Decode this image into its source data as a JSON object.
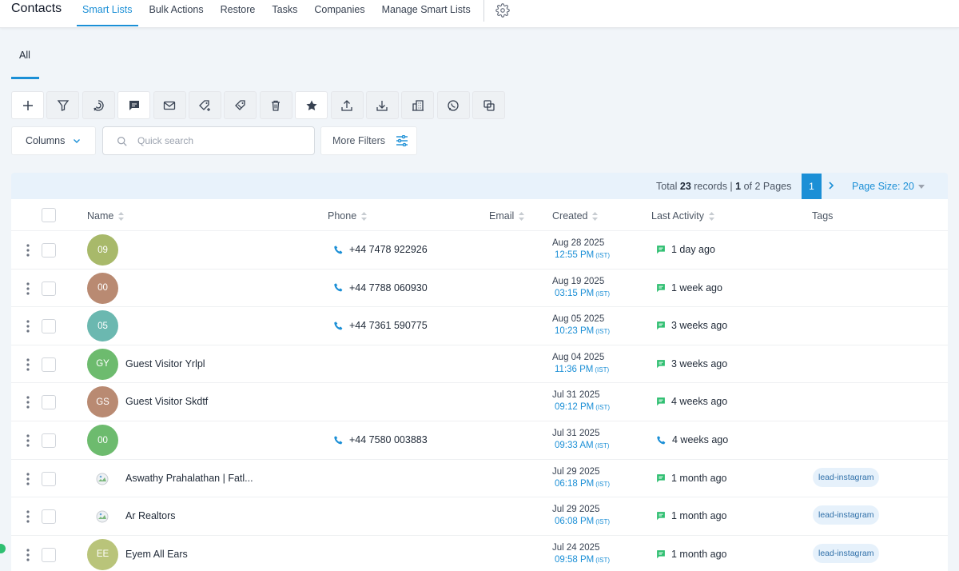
{
  "app": {
    "title": "Contacts"
  },
  "nav": {
    "tabs": [
      {
        "label": "Smart Lists",
        "active": true
      },
      {
        "label": "Bulk Actions"
      },
      {
        "label": "Restore"
      },
      {
        "label": "Tasks"
      },
      {
        "label": "Companies"
      },
      {
        "label": "Manage Smart Lists"
      }
    ]
  },
  "subtabs": {
    "all": "All"
  },
  "toolbar": {
    "buttons": [
      {
        "icon": "plus-icon"
      },
      {
        "icon": "filter-icon"
      },
      {
        "icon": "pipeline-icon"
      },
      {
        "icon": "message-icon"
      },
      {
        "icon": "email-icon"
      },
      {
        "icon": "add-tag-icon"
      },
      {
        "icon": "remove-tag-icon"
      },
      {
        "icon": "delete-icon"
      },
      {
        "icon": "star-icon"
      },
      {
        "icon": "upload-icon"
      },
      {
        "icon": "download-icon"
      },
      {
        "icon": "company-icon"
      },
      {
        "icon": "whatsapp-icon"
      },
      {
        "icon": "merge-icon"
      }
    ]
  },
  "filters": {
    "columns_label": "Columns",
    "search_placeholder": "Quick search",
    "more_filters_label": "More Filters"
  },
  "pager": {
    "total_prefix": "Total ",
    "total_count": "23",
    "total_mid": " records | ",
    "current_page": "1",
    "page_suffix": " of 2 Pages",
    "page_button": "1",
    "page_size": "Page Size: 20"
  },
  "table": {
    "headers": {
      "name": "Name",
      "phone": "Phone",
      "email": "Email",
      "created": "Created",
      "last_activity": "Last Activity",
      "tags": "Tags"
    },
    "rows": [
      {
        "avatar": "09",
        "avatar_color": "#a8b96a",
        "name": "",
        "phone": "+44 7478 922926",
        "date": "Aug 28 2025",
        "time": "12:55 PM",
        "tz": "(IST)",
        "activity": "1 day ago",
        "activity_type": "message",
        "tag": ""
      },
      {
        "avatar": "00",
        "avatar_color": "#b98a72",
        "name": "",
        "phone": "+44 7788 060930",
        "date": "Aug 19 2025",
        "time": "03:15 PM",
        "tz": "(IST)",
        "activity": "1 week ago",
        "activity_type": "message",
        "tag": ""
      },
      {
        "avatar": "05",
        "avatar_color": "#6bb8b0",
        "name": "",
        "phone": "+44 7361 590775",
        "date": "Aug 05 2025",
        "time": "10:23 PM",
        "tz": "(IST)",
        "activity": "3 weeks ago",
        "activity_type": "message",
        "tag": ""
      },
      {
        "avatar": "GY",
        "avatar_color": "#6dbb6e",
        "name": "Guest Visitor Yrlpl",
        "phone": "",
        "date": "Aug 04 2025",
        "time": "11:36 PM",
        "tz": "(IST)",
        "activity": "3 weeks ago",
        "activity_type": "message",
        "tag": ""
      },
      {
        "avatar": "GS",
        "avatar_color": "#b98a72",
        "name": "Guest Visitor Skdtf",
        "phone": "",
        "date": "Jul 31 2025",
        "time": "09:12 PM",
        "tz": "(IST)",
        "activity": "4 weeks ago",
        "activity_type": "message",
        "tag": ""
      },
      {
        "avatar": "00",
        "avatar_color": "#6dbb6e",
        "name": "",
        "phone": "+44 7580 003883",
        "date": "Jul 31 2025",
        "time": "09:33 AM",
        "tz": "(IST)",
        "activity": "4 weeks ago",
        "activity_type": "call",
        "tag": ""
      },
      {
        "avatar": "",
        "avatar_color": "",
        "name": "Aswathy Prahalathan | Fatl...",
        "phone": "",
        "date": "Jul 29 2025",
        "time": "06:18 PM",
        "tz": "(IST)",
        "activity": "1 month ago",
        "activity_type": "message",
        "tag": "lead-instagram"
      },
      {
        "avatar": "",
        "avatar_color": "",
        "name": "Ar Realtors",
        "phone": "",
        "date": "Jul 29 2025",
        "time": "06:08 PM",
        "tz": "(IST)",
        "activity": "1 month ago",
        "activity_type": "message",
        "tag": "lead-instagram"
      },
      {
        "avatar": "EE",
        "avatar_color": "#b9c47a",
        "name": "Eyem All Ears",
        "phone": "",
        "date": "Jul 24 2025",
        "time": "09:58 PM",
        "tz": "(IST)",
        "activity": "1 month ago",
        "activity_type": "message",
        "tag": "lead-instagram"
      }
    ]
  },
  "colors": {
    "accent": "#1b8fd6",
    "activity_green": "#2fbf71"
  }
}
